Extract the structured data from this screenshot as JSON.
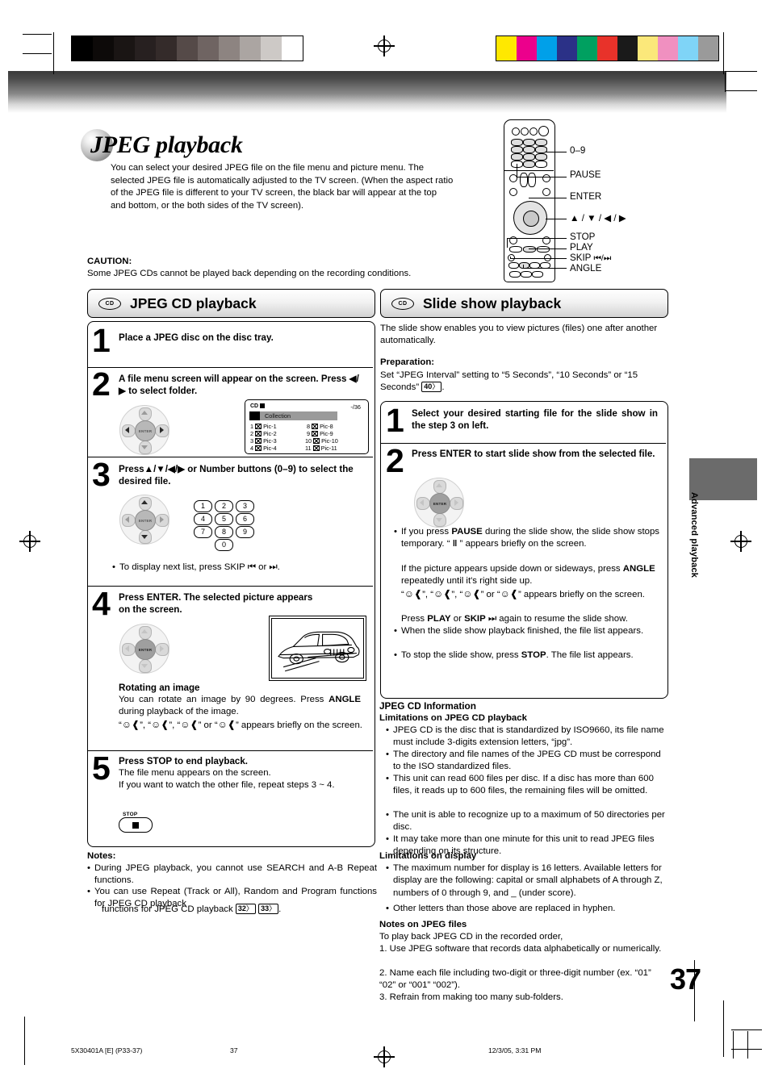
{
  "heading": {
    "title": "JPEG playback",
    "intro": "You can select your desired JPEG file on the file menu and picture menu. The selected JPEG file is automatically adjusted to the TV screen. (When the aspect ratio of the JPEG file is different to your TV screen, the black bar will appear at the top and bottom, or the both sides of the TV screen).",
    "caution_label": "CAUTION:",
    "caution_text": "Some JPEG CDs cannot be played back depending on the recording conditions."
  },
  "remote": {
    "callouts": [
      "0–9",
      "PAUSE",
      "ENTER",
      "▲ / ▼ / ◀ / ▶",
      "STOP",
      "PLAY",
      "SKIP",
      "ANGLE"
    ],
    "skip_glyphs": "⏮/⏭"
  },
  "left_section": {
    "cd_badge": "CD",
    "header": "JPEG CD playback",
    "steps": [
      {
        "num": "1",
        "text": "Place a JPEG disc on the disc tray."
      },
      {
        "num": "2",
        "text": "A file menu screen will appear on the screen. Press ◀/▶ to select folder."
      },
      {
        "num": "3",
        "text": "Press▲/▼/◀/▶ or Number buttons (0–9) to select the desired file.",
        "bullet": "To display next list, press SKIP ⏮ or ⏭."
      },
      {
        "num": "4",
        "text": "Press ENTER. The selected picture appears on the screen.",
        "sub_title": "Rotating an image",
        "sub_body": "You can rotate an image by 90 degrees. Press ANGLE during playback of the image.",
        "sub_body2": "appears briefly on the screen."
      },
      {
        "num": "5",
        "text": "Press STOP to end playback.",
        "body1": "The file menu appears on the screen.",
        "body2": "If you want to watch the other file, repeat steps 3 ~ 4.",
        "stop_label": "STOP"
      }
    ],
    "osd": {
      "disc_type": "CD",
      "counter": "-/36",
      "folder": "Collection",
      "files_left": [
        {
          "n": "1",
          "name": "Pic-1"
        },
        {
          "n": "2",
          "name": "Pic-2"
        },
        {
          "n": "3",
          "name": "Pic-3"
        },
        {
          "n": "4",
          "name": "Pic-4"
        }
      ],
      "files_right": [
        {
          "n": "8",
          "name": "Pic-8"
        },
        {
          "n": "9",
          "name": "Pic-9"
        },
        {
          "n": "10",
          "name": "Pic-10"
        },
        {
          "n": "11",
          "name": "Pic-11"
        }
      ]
    },
    "numpad": [
      "1",
      "2",
      "3",
      "4",
      "5",
      "6",
      "7",
      "8",
      "9",
      "0"
    ],
    "notes_title": "Notes:",
    "notes": [
      "During JPEG playback, you cannot use SEARCH and A-B Repeat functions.",
      "You can use Repeat (Track or All), Random and Program functions for JPEG CD playback"
    ],
    "note_refs": [
      "32",
      "33"
    ]
  },
  "right_section": {
    "cd_badge": "CD",
    "header": "Slide show playback",
    "intro": "The slide show enables you to view pictures (files) one after another automatically.",
    "prep_label": "Preparation:",
    "prep_text_a": "Set “JPEG Interval” setting to “5 Seconds”, “10 Seconds” or “15 Seconds”",
    "prep_ref": "40",
    "steps": [
      {
        "num": "1",
        "text": "Select your desired starting file for the slide show in the step 3 on left."
      },
      {
        "num": "2",
        "text": "Press ENTER to start slide show from the selected file."
      }
    ],
    "bullets": [
      "If you press PAUSE during the slide show, the slide show stops temporary. “ ‖ ” appears briefly on the screen.",
      "If the picture appears upside down or sideways, press ANGLE repeatedly until it's right side up.",
      "appears briefly on the screen.",
      "Press PLAY or SKIP ⏭ again to resume the slide show.",
      "When the slide show playback finished, the file list appears.",
      "To stop the slide show, press STOP. The file list appears."
    ],
    "info_title": "JPEG CD Information",
    "lim_play_title": "Limitations on JPEG CD playback",
    "lim_play": [
      "JPEG CD is the disc that is standardized by ISO9660, its file name must include 3-digits extension letters, “jpg”.",
      "The directory and file names of the JPEG CD must be correspond to the ISO standardized files.",
      "This unit can read 600 files per disc. If a disc has more than 600 files, it reads up to 600 files, the remaining files will be omitted.",
      "The unit is able to recognize up to a maximum of 50 directories per disc.",
      "It may take more than one minute for this unit to read JPEG files depending on its structure."
    ],
    "lim_disp_title": "Limitations on display",
    "lim_disp": [
      "The maximum number for display is 16 letters. Available letters for display are the following: capital or small alphabets of A through Z, numbers of 0 through 9, and _ (under score).",
      "Other letters than those above are replaced in hyphen."
    ],
    "notes_jpeg_title": "Notes on JPEG files",
    "notes_jpeg_lead": "To play back JPEG CD in the recorded order,",
    "notes_jpeg": [
      "1. Use JPEG software that records data alphabetically or numerically.",
      "2. Name each file including two-digit or three-digit number (ex. “01” “02” or “001” “002”).",
      "3. Refrain from making too many sub-folders."
    ]
  },
  "side_tab": "Advanced playback",
  "page_number": "37",
  "footer": {
    "doc_id": "5X30401A [E] (P33-37)",
    "page": "37",
    "timestamp": "12/3/05, 3:31 PM"
  },
  "colors": {
    "grey_steps": [
      "#000000",
      "#0d0a09",
      "#1a1514",
      "#272020",
      "#342b2a",
      "#554a48",
      "#6f6462",
      "#8d8481",
      "#aba5a2",
      "#cdc9c6",
      "#ffffff"
    ],
    "color_steps": [
      "#ffe800",
      "#ec008c",
      "#00a0e9",
      "#2b3187",
      "#00a060",
      "#e8322a",
      "#1a1a1a",
      "#fbe87a",
      "#f090c0",
      "#7fd4f7",
      "#9a9a9a"
    ]
  }
}
